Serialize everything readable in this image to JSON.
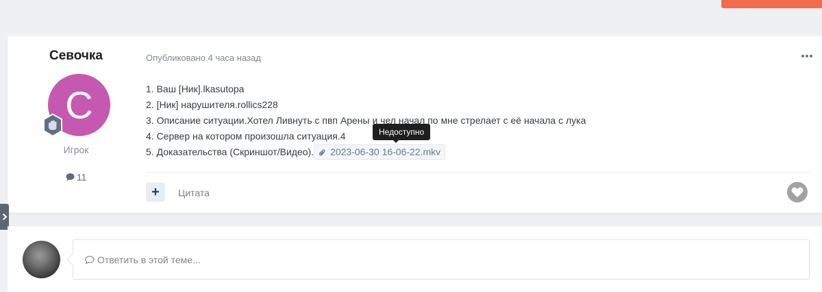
{
  "post": {
    "author": {
      "name": "Севочка",
      "avatar_letter": "C",
      "avatar_color": "#c558b1",
      "rank_title": "Игрок",
      "post_count": "11"
    },
    "posted_time": "Опубликовано 4 часа назад",
    "lines": [
      "1. Ваш [Ник].lkasutopa",
      "2. [Ник] нарушителя.rollics228",
      "3. Описание ситуации.Хотел Ливнуть с пвп Арены и чел начал по мне стрелает с её начала с лука",
      "4. Сервер на котором произошла ситуация.4",
      "5. Доказательства (Скриншот/Видео)."
    ],
    "attachment": {
      "filename": "2023-06-30 16-06-22.mkv",
      "tooltip": "Недоступно"
    },
    "actions": {
      "rep_plus": "+",
      "quote_label": "Цитата"
    }
  },
  "reply": {
    "placeholder": "Ответить в этой теме..."
  },
  "colors": {
    "accent": "#f26c4f",
    "like_gray": "#a2a2a2"
  }
}
